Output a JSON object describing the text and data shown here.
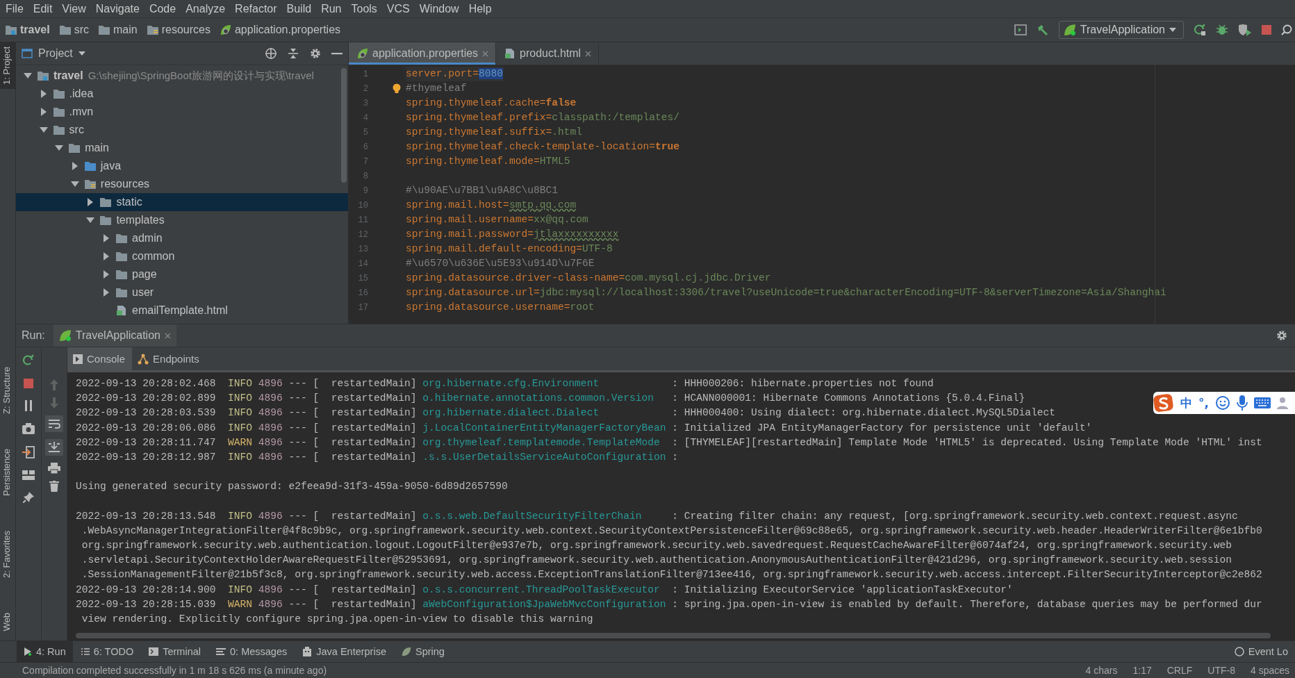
{
  "menu": [
    "File",
    "Edit",
    "View",
    "Navigate",
    "Code",
    "Analyze",
    "Refactor",
    "Build",
    "Run",
    "Tools",
    "VCS",
    "Window",
    "Help"
  ],
  "breadcrumb": [
    {
      "label": "travel",
      "kind": "module"
    },
    {
      "label": "src",
      "kind": "folder"
    },
    {
      "label": "main",
      "kind": "folder"
    },
    {
      "label": "resources",
      "kind": "resource_folder"
    },
    {
      "label": "application.properties",
      "kind": "spring_file"
    }
  ],
  "toolbar": {
    "run_config": "TravelApplication"
  },
  "side_tabs_top": [
    {
      "label": "1: Project",
      "selected": true
    }
  ],
  "side_tabs_bottom": [
    {
      "label": "Z: Structure",
      "selected": false
    },
    {
      "label": "Persistence",
      "selected": false
    },
    {
      "label": "2: Favorites",
      "selected": false
    },
    {
      "label": "Web",
      "selected": false
    }
  ],
  "project": {
    "title": "Project",
    "tree": [
      {
        "label": "travel",
        "path": "G:\\shejiing\\SpringBoot旅游网的设计与实现\\travel",
        "kind": "module",
        "expanded": true,
        "selected": false,
        "children": [
          {
            "label": ".idea",
            "kind": "folder",
            "expanded": false,
            "selected": false
          },
          {
            "label": ".mvn",
            "kind": "folder",
            "expanded": false,
            "selected": false
          },
          {
            "label": "src",
            "kind": "folder",
            "expanded": true,
            "selected": false,
            "children": [
              {
                "label": "main",
                "kind": "folder",
                "expanded": true,
                "selected": false,
                "children": [
                  {
                    "label": "java",
                    "kind": "source_folder",
                    "expanded": false,
                    "selected": false
                  },
                  {
                    "label": "resources",
                    "kind": "resource_folder",
                    "expanded": true,
                    "selected": false,
                    "children": [
                      {
                        "label": "static",
                        "kind": "folder",
                        "expanded": false,
                        "selected": true
                      },
                      {
                        "label": "templates",
                        "kind": "folder",
                        "expanded": true,
                        "selected": false,
                        "children": [
                          {
                            "label": "admin",
                            "kind": "folder",
                            "expanded": false,
                            "selected": false
                          },
                          {
                            "label": "common",
                            "kind": "folder",
                            "expanded": false,
                            "selected": false
                          },
                          {
                            "label": "page",
                            "kind": "folder",
                            "expanded": false,
                            "selected": false
                          },
                          {
                            "label": "user",
                            "kind": "folder",
                            "expanded": false,
                            "selected": false
                          },
                          {
                            "label": "emailTemplate.html",
                            "kind": "html_file",
                            "selected": false
                          }
                        ]
                      }
                    ]
                  }
                ]
              }
            ]
          }
        ]
      }
    ]
  },
  "editor": {
    "tabs": [
      {
        "label": "application.properties",
        "kind": "spring_file",
        "selected": true
      },
      {
        "label": "product.html",
        "kind": "html_file",
        "selected": false
      }
    ],
    "lines": [
      {
        "n": "1",
        "kind": "property",
        "key": "server.port=",
        "value": "8080",
        "highlighted": true,
        "keyword": false,
        "typo": false
      },
      {
        "n": "2",
        "kind": "comment",
        "text": "#thymeleaf",
        "hint": true
      },
      {
        "n": "3",
        "kind": "property",
        "key": "spring.thymeleaf.cache=",
        "value": "false",
        "highlighted": false,
        "keyword": true,
        "typo": false
      },
      {
        "n": "4",
        "kind": "property",
        "key": "spring.thymeleaf.prefix=",
        "value": "classpath:/templates/",
        "highlighted": false,
        "keyword": false,
        "typo": false
      },
      {
        "n": "5",
        "kind": "property",
        "key": "spring.thymeleaf.suffix=",
        "value": ".html",
        "highlighted": false,
        "keyword": false,
        "typo": false
      },
      {
        "n": "6",
        "kind": "property",
        "key": "spring.thymeleaf.check-template-location=",
        "value": "true",
        "highlighted": false,
        "keyword": true,
        "typo": false
      },
      {
        "n": "7",
        "kind": "property",
        "key": "spring.thymeleaf.mode=",
        "value": "HTML5",
        "highlighted": false,
        "keyword": false,
        "typo": false
      },
      {
        "n": "8",
        "kind": "blank"
      },
      {
        "n": "9",
        "kind": "comment",
        "text": "#\\u90AE\\u7BB1\\u9A8C\\u8BC1",
        "hint": false
      },
      {
        "n": "10",
        "kind": "property",
        "key": "spring.mail.host=",
        "value": "smtp.qq.com",
        "highlighted": false,
        "keyword": false,
        "typo": true
      },
      {
        "n": "11",
        "kind": "property",
        "key": "spring.mail.username=",
        "value": "xx@qq.com",
        "highlighted": false,
        "keyword": false,
        "typo": false
      },
      {
        "n": "12",
        "kind": "property",
        "key": "spring.mail.password=",
        "value": "jtlaxxxxxxxxxx",
        "highlighted": false,
        "keyword": false,
        "typo": true
      },
      {
        "n": "13",
        "kind": "property",
        "key": "spring.mail.default-encoding=",
        "value": "UTF-8",
        "highlighted": false,
        "keyword": false,
        "typo": false
      },
      {
        "n": "14",
        "kind": "comment",
        "text": "#\\u6570\\u636E\\u5E93\\u914D\\u7F6E",
        "hint": false
      },
      {
        "n": "15",
        "kind": "property",
        "key": "spring.datasource.driver-class-name=",
        "value": "com.mysql.cj.jdbc.Driver",
        "highlighted": false,
        "keyword": false,
        "typo": false
      },
      {
        "n": "16",
        "kind": "property",
        "key": "spring.datasource.url=",
        "value": "jdbc:mysql://localhost:3306/travel?useUnicode=true&characterEncoding=UTF-8&serverTimezone=Asia/Shanghai",
        "highlighted": false,
        "keyword": false,
        "typo": false
      },
      {
        "n": "17",
        "kind": "property",
        "key": "spring.datasource.username=",
        "value": "root",
        "highlighted": false,
        "keyword": false,
        "typo": false
      }
    ]
  },
  "run": {
    "label": "Run:",
    "tab": "TravelApplication",
    "subtabs": [
      {
        "label": "Console",
        "selected": true
      },
      {
        "label": "Endpoints",
        "selected": false
      }
    ],
    "lines": [
      {
        "kind": "log",
        "time": "2022-09-13 20:28:02.468",
        "level": "INFO",
        "pid": "4896",
        "sep": "--- [",
        "thread": "  restartedMain]",
        "logger": "org.hibernate.cfg.Environment",
        "message": ": HHH000206: hibernate.properties not found"
      },
      {
        "kind": "log",
        "time": "2022-09-13 20:28:02.899",
        "level": "INFO",
        "pid": "4896",
        "sep": "--- [",
        "thread": "  restartedMain]",
        "logger": "o.hibernate.annotations.common.Version",
        "message": ": HCANN000001: Hibernate Commons Annotations {5.0.4.Final}"
      },
      {
        "kind": "log",
        "time": "2022-09-13 20:28:03.539",
        "level": "INFO",
        "pid": "4896",
        "sep": "--- [",
        "thread": "  restartedMain]",
        "logger": "org.hibernate.dialect.Dialect",
        "message": ": HHH000400: Using dialect: org.hibernate.dialect.MySQL5Dialect"
      },
      {
        "kind": "log",
        "time": "2022-09-13 20:28:06.086",
        "level": "INFO",
        "pid": "4896",
        "sep": "--- [",
        "thread": "  restartedMain]",
        "logger": "j.LocalContainerEntityManagerFactoryBean",
        "message": ": Initialized JPA EntityManagerFactory for persistence unit 'default'"
      },
      {
        "kind": "log",
        "time": "2022-09-13 20:28:11.747",
        "level": "WARN",
        "pid": "4896",
        "sep": "--- [",
        "thread": "  restartedMain]",
        "logger": "org.thymeleaf.templatemode.TemplateMode",
        "message": ": [THYMELEAF][restartedMain] Template Mode 'HTML5' is deprecated. Using Template Mode 'HTML' inst"
      },
      {
        "kind": "log",
        "time": "2022-09-13 20:28:12.987",
        "level": "INFO",
        "pid": "4896",
        "sep": "--- [",
        "thread": "  restartedMain]",
        "logger": ".s.s.UserDetailsServiceAutoConfiguration",
        "message": ":"
      },
      {
        "kind": "blank"
      },
      {
        "kind": "text",
        "text": "Using generated security password: e2feea9d-31f3-459a-9050-6d89d2657590"
      },
      {
        "kind": "blank"
      },
      {
        "kind": "log",
        "time": "2022-09-13 20:28:13.548",
        "level": "INFO",
        "pid": "4896",
        "sep": "--- [",
        "thread": "  restartedMain]",
        "logger": "o.s.s.web.DefaultSecurityFilterChain",
        "message": ": Creating filter chain: any request, [org.springframework.security.web.context.request.async"
      },
      {
        "kind": "continuation",
        "text": ".WebAsyncManagerIntegrationFilter@4f8c9b9c, org.springframework.security.web.context.SecurityContextPersistenceFilter@69c88e65, org.springframework.security.web.header.HeaderWriterFilter@6e1bfb0"
      },
      {
        "kind": "continuation",
        "text": "org.springframework.security.web.authentication.logout.LogoutFilter@e937e7b, org.springframework.security.web.savedrequest.RequestCacheAwareFilter@6074af24, org.springframework.security.web"
      },
      {
        "kind": "continuation",
        "text": ".servletapi.SecurityContextHolderAwareRequestFilter@52953691, org.springframework.security.web.authentication.AnonymousAuthenticationFilter@421d296, org.springframework.security.web.session"
      },
      {
        "kind": "continuation",
        "text": ".SessionManagementFilter@21b5f3c8, org.springframework.security.web.access.ExceptionTranslationFilter@713ee416, org.springframework.security.web.access.intercept.FilterSecurityInterceptor@c2e862"
      },
      {
        "kind": "log",
        "time": "2022-09-13 20:28:14.900",
        "level": "INFO",
        "pid": "4896",
        "sep": "--- [",
        "thread": "  restartedMain]",
        "logger": "o.s.s.concurrent.ThreadPoolTaskExecutor",
        "message": ": Initializing ExecutorService 'applicationTaskExecutor'"
      },
      {
        "kind": "log",
        "time": "2022-09-13 20:28:15.039",
        "level": "WARN",
        "pid": "4896",
        "sep": "--- [",
        "thread": "  restartedMain]",
        "logger": "aWebConfiguration$JpaWebMvcConfiguration",
        "message": ": spring.jpa.open-in-view is enabled by default. Therefore, database queries may be performed dur"
      },
      {
        "kind": "continuation",
        "text": "view rendering. Explicitly configure spring.jpa.open-in-view to disable this warning"
      }
    ]
  },
  "ime": {
    "mode": "中",
    "punct": "°,"
  },
  "tool_tabs": [
    {
      "label": "4: Run",
      "kind": "run",
      "selected": true
    },
    {
      "label": "6: TODO",
      "kind": "todo",
      "selected": false
    },
    {
      "label": "Terminal",
      "kind": "terminal",
      "selected": false
    },
    {
      "label": "0: Messages",
      "kind": "messages",
      "selected": false
    },
    {
      "label": "Java Enterprise",
      "kind": "enterprise",
      "selected": false
    },
    {
      "label": "Spring",
      "kind": "spring",
      "selected": false
    }
  ],
  "event_log": "Event Lo",
  "status": {
    "message": "Compilation completed successfully in 1 m 18 s 626 ms (a minute ago)",
    "items": [
      "4 chars",
      "1:17",
      "CRLF",
      "UTF-8",
      "4 spaces"
    ]
  }
}
